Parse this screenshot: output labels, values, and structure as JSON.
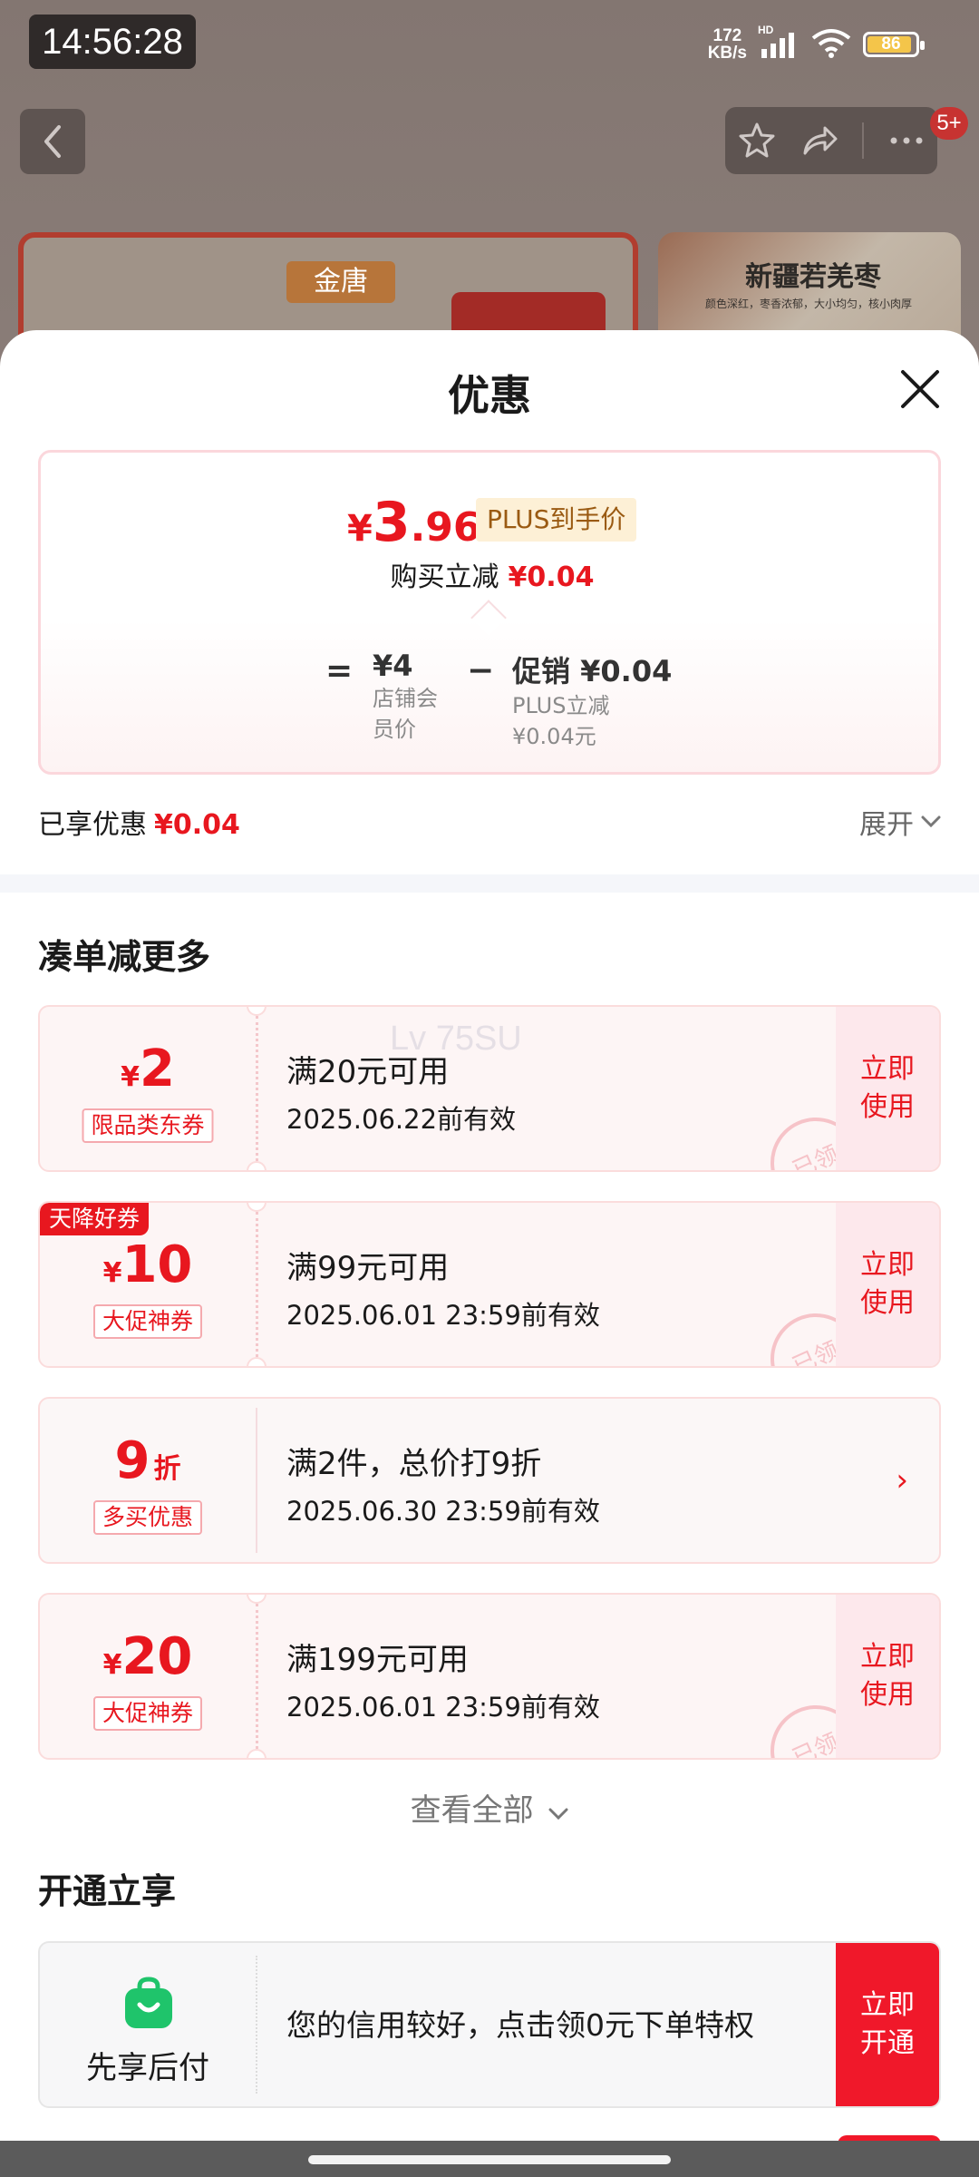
{
  "status_bar": {
    "time": "14:56:28",
    "net_speed_value": "172",
    "net_speed_unit": "KB/s",
    "hd_label": "HD",
    "battery_level": "86"
  },
  "header": {
    "badge": "5+",
    "back_icon": "chevron-left-icon",
    "actions": [
      "star-icon",
      "share-icon",
      "more-icon"
    ]
  },
  "background": {
    "brand_tag": "金唐",
    "right_card_title": "新疆若羌枣",
    "right_card_subtitle": "颜色深红，枣香浓郁，大小均匀，核小肉厚"
  },
  "sheet": {
    "title": "优惠",
    "price": {
      "yen": "¥",
      "integer": "3",
      "decimal": ".96",
      "tag": "PLUS到手价",
      "buy_label": "购买立减",
      "buy_amount": "¥0.04",
      "equals": "=",
      "base_value": "¥4",
      "base_label": "店铺会员价",
      "minus": "−",
      "promo_value": "促销 ¥0.04",
      "promo_label_1": "PLUS立减",
      "promo_label_2": "¥0.04元"
    },
    "enjoyed_label": "已享优惠",
    "enjoyed_amount": "¥0.04",
    "expand_label": "展开",
    "section_more": "凑单减更多",
    "coupons": [
      {
        "yen": "¥",
        "amount": "2",
        "unit": "",
        "type": "限品类东券",
        "condition": "满20元可用",
        "validity": "2025.06.22前有效",
        "action": "立即使用",
        "stamp": "已领",
        "ribbon": ""
      },
      {
        "yen": "¥",
        "amount": "10",
        "unit": "",
        "type": "大促神券",
        "condition": "满99元可用",
        "validity": "2025.06.01 23:59前有效",
        "action": "立即使用",
        "stamp": "已领",
        "ribbon": "天降好券"
      },
      {
        "yen": "",
        "amount": "9",
        "unit": "折",
        "type": "多买优惠",
        "condition": "满2件，总价打9折",
        "validity": "2025.06.30 23:59前有效",
        "action": "›",
        "stamp": "",
        "ribbon": ""
      },
      {
        "yen": "¥",
        "amount": "20",
        "unit": "",
        "type": "大促神券",
        "condition": "满199元可用",
        "validity": "2025.06.01 23:59前有效",
        "action": "立即使用",
        "stamp": "已领",
        "ribbon": ""
      }
    ],
    "watermark": "Lv 75SU",
    "see_all": "查看全部",
    "section_open": "开通立享",
    "bnpl": {
      "label": "先享后付",
      "text": "您的信用较好，点击领0元下单特权",
      "action": "立即开通"
    }
  },
  "colors": {
    "accent_red": "#e8171f",
    "plus_tag_bg": "#fdf0d6",
    "bnpl_green": "#1fc46b"
  }
}
